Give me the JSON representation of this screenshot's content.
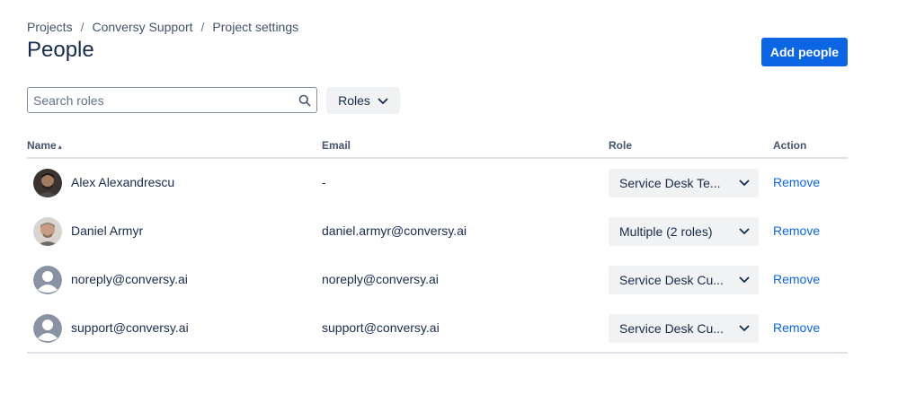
{
  "breadcrumb": [
    "Projects",
    "Conversy Support",
    "Project settings"
  ],
  "page_title": "People",
  "add_button": "Add people",
  "search": {
    "placeholder": "Search roles",
    "value": ""
  },
  "roles_filter": "Roles",
  "columns": {
    "name": "Name",
    "email": "Email",
    "role": "Role",
    "action": "Action"
  },
  "colors": {
    "accent": "#0c66e4",
    "text": "#172b4d",
    "subtle": "#f1f2f4"
  },
  "rows": [
    {
      "name": "Alex Alexandrescu",
      "email": "-",
      "role": "Service Desk Te...",
      "action": "Remove",
      "avatar": "photo-avatar"
    },
    {
      "name": "Daniel Armyr",
      "email": "daniel.armyr@conversy.ai",
      "role": "Multiple (2 roles)",
      "action": "Remove",
      "avatar": "photo-avatar"
    },
    {
      "name": "noreply@conversy.ai",
      "email": "noreply@conversy.ai",
      "role": "Service Desk Cu...",
      "action": "Remove",
      "avatar": "default-user-avatar"
    },
    {
      "name": "support@conversy.ai",
      "email": "support@conversy.ai",
      "role": "Service Desk Cu...",
      "action": "Remove",
      "avatar": "default-user-avatar"
    }
  ]
}
